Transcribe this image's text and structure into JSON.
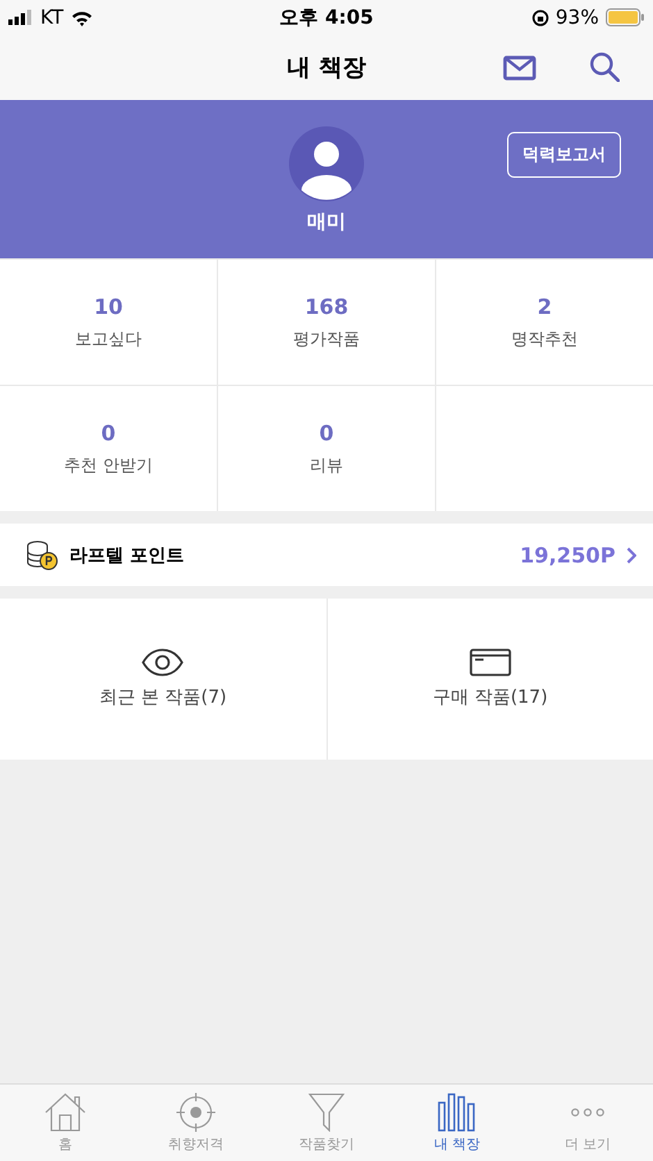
{
  "status_bar": {
    "carrier": "KT",
    "time": "오후 4:05",
    "battery": "93%"
  },
  "nav": {
    "title": "내 책장"
  },
  "profile": {
    "name": "매미",
    "report_button": "덕력보고서"
  },
  "stats": [
    {
      "value": "10",
      "label": "보고싶다"
    },
    {
      "value": "168",
      "label": "평가작품"
    },
    {
      "value": "2",
      "label": "명작추천"
    },
    {
      "value": "0",
      "label": "추천 안받기"
    },
    {
      "value": "0",
      "label": "리뷰"
    }
  ],
  "points": {
    "label": "라프텔 포인트",
    "value": "19,250P"
  },
  "shortcuts": [
    {
      "kind": "eye",
      "label": "최근 본 작품(7)"
    },
    {
      "kind": "card",
      "label": "구매 작품(17)"
    }
  ],
  "tabs": [
    {
      "kind": "home",
      "label": "홈",
      "selected": false
    },
    {
      "kind": "target",
      "label": "취향저격",
      "selected": false
    },
    {
      "kind": "filter",
      "label": "작품찾기",
      "selected": false
    },
    {
      "kind": "shelf",
      "label": "내 책장",
      "selected": true
    },
    {
      "kind": "more",
      "label": "더 보기",
      "selected": false
    }
  ]
}
